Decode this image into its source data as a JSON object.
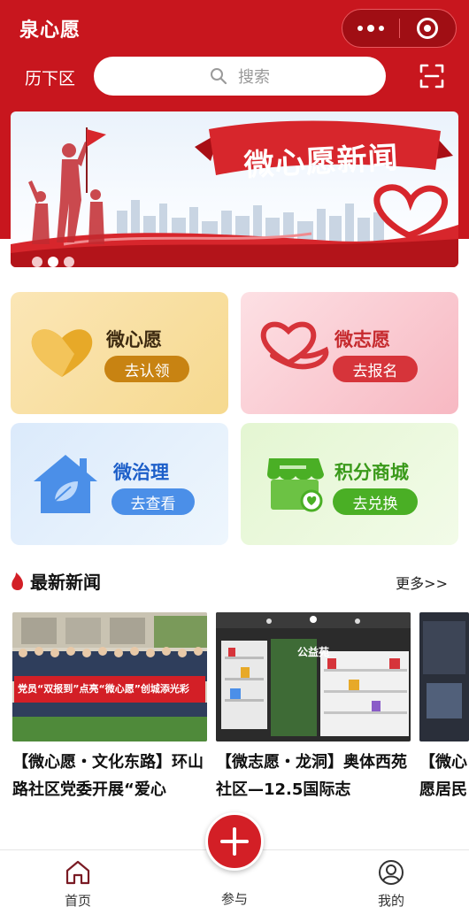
{
  "header": {
    "title": "泉心愿",
    "district": "历下区",
    "search_placeholder": "搜索"
  },
  "banner": {
    "title": "微心愿新闻",
    "slide_count": 3,
    "active_slide": 2
  },
  "cards": [
    {
      "title": "微心愿",
      "action": "去认领",
      "icon": "heart-icon"
    },
    {
      "title": "微志愿",
      "action": "去报名",
      "icon": "hand-heart-icon"
    },
    {
      "title": "微治理",
      "action": "去查看",
      "icon": "house-leaf-icon"
    },
    {
      "title": "积分商城",
      "action": "去兑换",
      "icon": "shop-icon"
    }
  ],
  "news": {
    "heading": "最新新闻",
    "more": "更多>>",
    "items": [
      {
        "text": "【微心愿・文化东路】环山路社区党委开展“爱心",
        "banner_text": "党员“双报到”点亮“微心愿”创城添光彩"
      },
      {
        "text": "【微志愿・龙洞】奥体西苑社区—12.5国际志",
        "sign_text": "公益苑"
      },
      {
        "text": "【微心愿居民"
      }
    ]
  },
  "tabbar": {
    "home": "首页",
    "join": "参与",
    "mine": "我的"
  },
  "colors": {
    "brand_red": "#c8161e",
    "gold": "#c88312",
    "blue": "#4b8fe8",
    "green": "#4aaf25"
  }
}
